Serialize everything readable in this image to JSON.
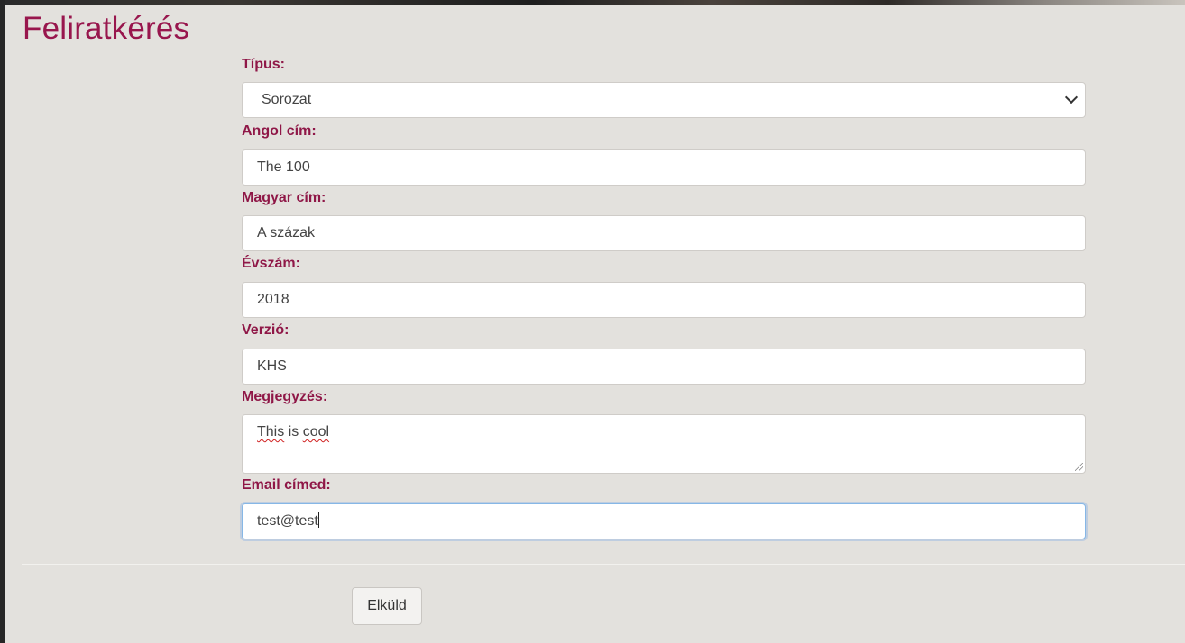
{
  "page": {
    "title": "Feliratkérés"
  },
  "form": {
    "type_label": "Típus:",
    "type_selected": "Sorozat",
    "english_title_label": "Angol cím:",
    "english_title_value": "The 100",
    "hungarian_title_label": "Magyar cím:",
    "hungarian_title_value": "A százak",
    "year_label": "Évszám:",
    "year_value": "2018",
    "version_label": "Verzió:",
    "version_value": "KHS",
    "note_label": "Megjegyzés:",
    "note_word1": "This",
    "note_word2": "is",
    "note_word3": "cool",
    "email_label": "Email címed:",
    "email_value": "test@test",
    "submit_label": "Elküld"
  },
  "colors": {
    "accent": "#98164d",
    "panel_bg": "#e3e1dd",
    "focus_border": "#86b7e6"
  }
}
